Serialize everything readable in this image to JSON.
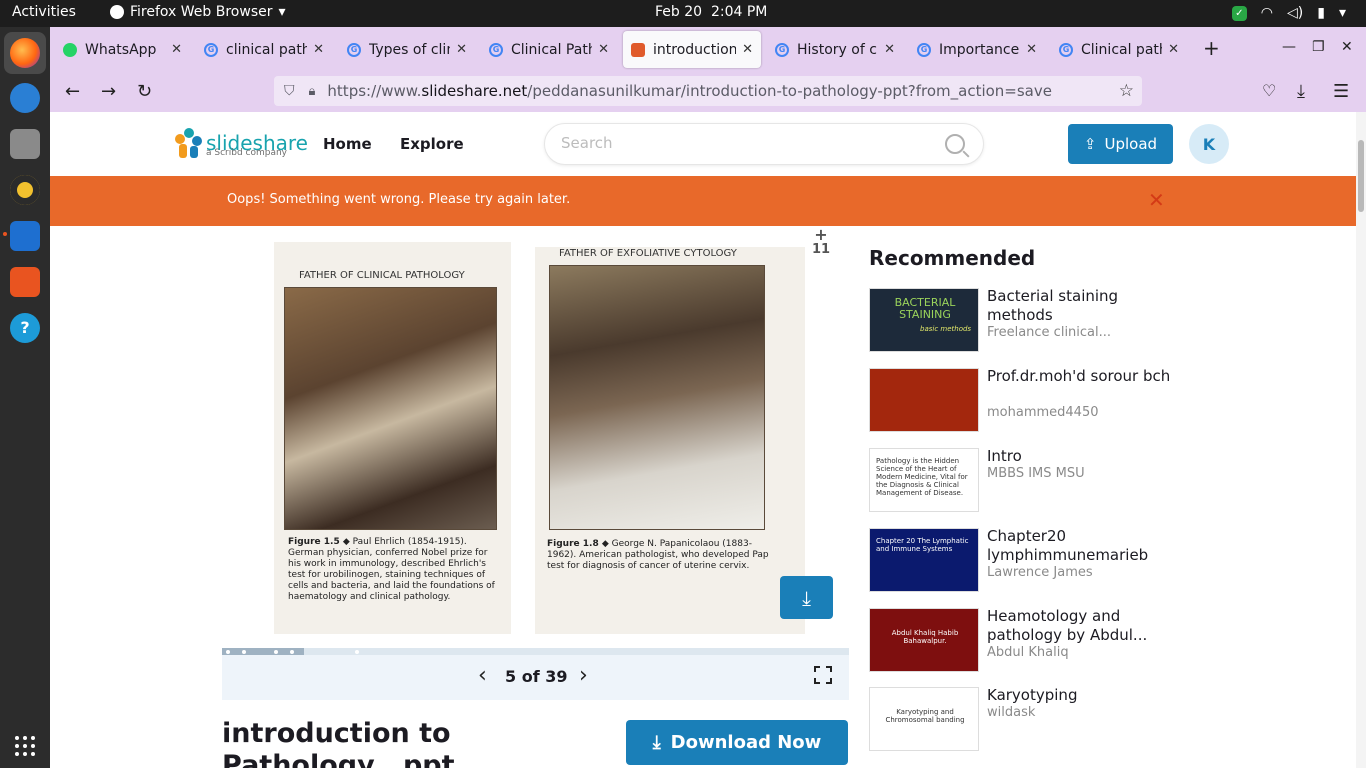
{
  "system": {
    "activities": "Activities",
    "app_name": "Firefox Web Browser",
    "date": "Feb 20",
    "time": "2:04 PM"
  },
  "tabs": [
    {
      "label": "WhatsApp",
      "favicon": "whatsapp-icon",
      "active": false
    },
    {
      "label": "clinical patho",
      "favicon": "google-icon",
      "active": false
    },
    {
      "label": "Types of clin",
      "favicon": "google-icon",
      "active": false
    },
    {
      "label": "Clinical Patho",
      "favicon": "google-icon",
      "active": false
    },
    {
      "label": "introduction",
      "favicon": "slideshare-icon",
      "active": true
    },
    {
      "label": "History of cli",
      "favicon": "google-icon",
      "active": false
    },
    {
      "label": "Importance o",
      "favicon": "google-icon",
      "active": false
    },
    {
      "label": "Clinical path",
      "favicon": "google-icon",
      "active": false
    }
  ],
  "address": {
    "prefix": "https://www.",
    "domain": "slideshare.net",
    "path": "/peddanasunilkumar/introduction-to-pathology-ppt?from_action=save"
  },
  "site": {
    "brand": "slideshare",
    "brand_sub": "a Scribd company",
    "nav_home": "Home",
    "nav_explore": "Explore",
    "search_placeholder": "Search",
    "upload_label": "Upload",
    "avatar_initial": "K"
  },
  "alert": {
    "message": "Oops! Something went wrong. Please try again later.",
    "close": "✕"
  },
  "viewer": {
    "page_add": "+",
    "page_number_badge": "11",
    "left_photo_title": "FATHER OF CLINICAL PATHOLOGY",
    "left_photo_caption_bold": "Figure 1.5 ◆",
    "left_photo_caption": "Paul Ehrlich (1854-1915). German physician, conferred Nobel prize for his work in immunology, described Ehrlich's test for urobilinogen, staining techniques of cells and bacteria, and laid the foundations of haematology and clinical pathology.",
    "right_photo_title": "FATHER OF EXFOLIATIVE CYTOLOGY",
    "right_photo_caption_bold": "Figure 1.8 ◆",
    "right_photo_caption": "George N. Papanicolaou (1883-1962). American pathologist, who developed Pap test for diagnosis of cancer of uterine cervix.",
    "slide_counter": "5 of 39",
    "progress": 0.13
  },
  "document": {
    "title": "introduction to Pathology...ppt",
    "download_label": "Download Now"
  },
  "recommended": {
    "heading": "Recommended",
    "items": [
      {
        "title": "Bacterial staining methods",
        "author": "Freelance clinical...",
        "thumb_text": "BACTERIAL STAINING",
        "thumb_sub": "basic methods",
        "thumb_bg": "#1d2a3a"
      },
      {
        "title": "Prof.dr.moh'd sorour bch",
        "author": "mohammed4450",
        "thumb_text": "",
        "thumb_sub": "",
        "thumb_bg": "#a3270d"
      },
      {
        "title": "Intro",
        "author": "MBBS IMS MSU",
        "thumb_text": "Pathology is the Hidden Science of the Heart of Modern Medicine, Vital for the Diagnosis & Clinical Management of Disease.",
        "thumb_sub": "",
        "thumb_bg": "#ffffff"
      },
      {
        "title": "Chapter20 lymphimmunemarieb",
        "author": "Lawrence James",
        "thumb_text": "Chapter 20 The Lymphatic and Immune Systems",
        "thumb_sub": "",
        "thumb_bg": "#0b1a6e"
      },
      {
        "title": "Heamotology and pathology by Abdul...",
        "author": "Abdul Khaliq",
        "thumb_text": "Abdul Khaliq Habib Bahawalpur.",
        "thumb_sub": "",
        "thumb_bg": "#7e0f0f"
      },
      {
        "title": "Karyotyping",
        "author": "wildask",
        "thumb_text": "Karyotyping and Chromosomal banding",
        "thumb_sub": "",
        "thumb_bg": "#ffffff"
      }
    ]
  }
}
